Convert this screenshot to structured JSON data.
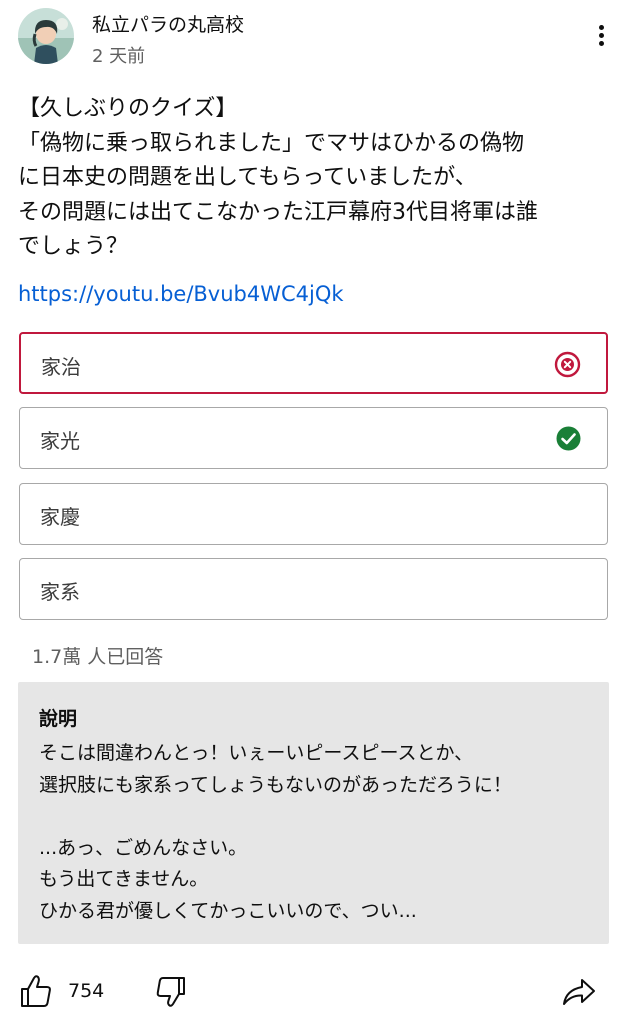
{
  "post": {
    "channel_name": "私立パラの丸高校",
    "timestamp": "2 天前",
    "text_lines": [
      "【久しぶりのクイズ】",
      "「偽物に乗っ取られました」でマサはひかるの偽物",
      "に日本史の問題を出してもらっていましたが、",
      "その問題には出てこなかった江戸幕府3代目将軍は誰",
      "でしょう？"
    ],
    "link": "https://youtu.be/Bvub4WC4jQk"
  },
  "quiz": {
    "options": [
      {
        "label": "家治",
        "state": "wrong",
        "icon": "x-circle-icon"
      },
      {
        "label": "家光",
        "state": "correct",
        "icon": "check-circle-icon"
      },
      {
        "label": "家慶",
        "state": "none"
      },
      {
        "label": "家系",
        "state": "none"
      }
    ],
    "answer_count": "1.7萬 人已回答",
    "colors": {
      "wrong": "#c0183d",
      "correct": "#1a7f37",
      "link": "#065fd4",
      "explanation_bg": "#e6e6e6"
    }
  },
  "explanation": {
    "title": "說明",
    "lines": [
      "そこは間違わんとっ！いぇーいピースピースとか、",
      "選択肢にも家系ってしょうもないのがあっただろうに！",
      "",
      "...あっ、ごめんなさい。",
      "もう出てきません。",
      "ひかる君が優しくてかっこいいので、つい..."
    ]
  },
  "actions": {
    "like_count": "754",
    "icons": [
      "thumbs-up-icon",
      "thumbs-down-icon",
      "share-icon"
    ]
  }
}
